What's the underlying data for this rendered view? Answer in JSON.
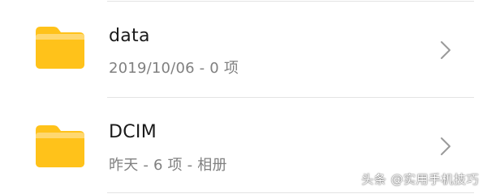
{
  "files": [
    {
      "name": "data",
      "meta": "2019/10/06 - 0 项",
      "icon": "folder-icon",
      "icon_color": "#FFC21A",
      "icon_tab_color": "#FFD870"
    },
    {
      "name": "DCIM",
      "meta": "昨天 - 6 项 - 相册",
      "icon": "folder-icon",
      "icon_color": "#FFC21A",
      "icon_tab_color": "#FFD870"
    }
  ],
  "chevron_icon": "chevron-right-icon",
  "watermark": "头条 @实用手机技巧"
}
